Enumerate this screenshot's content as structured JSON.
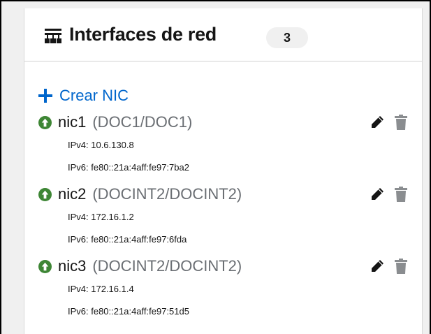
{
  "card": {
    "title": "Interfaces de red",
    "count": "3"
  },
  "actions": {
    "create_label": "Crear NIC"
  },
  "nics": [
    {
      "name": "nic1",
      "network": "(DOC1/DOC1)",
      "ipv4": "IPv4: 10.6.130.8",
      "ipv6": "IPv6: fe80::21a:4aff:fe97:7ba2",
      "status": "up"
    },
    {
      "name": "nic2",
      "network": "(DOCINT2/DOCINT2)",
      "ipv4": "IPv4: 172.16.1.2",
      "ipv6": "IPv6: fe80::21a:4aff:fe97:6fda",
      "status": "up"
    },
    {
      "name": "nic3",
      "network": "(DOCINT2/DOCINT2)",
      "ipv4": "IPv4: 172.16.1.4",
      "ipv6": "IPv6: fe80::21a:4aff:fe97:51d5",
      "status": "up"
    }
  ],
  "icons": {
    "header": "network-icon",
    "create": "plus-icon",
    "status": "arrow-up-circle-icon",
    "edit": "pencil-icon",
    "delete": "trash-icon"
  },
  "colors": {
    "link": "#0066cc",
    "status_up": "#3e8635",
    "muted": "#6a6e73",
    "action_icon": "#151515",
    "delete_icon": "#8a8d90"
  }
}
